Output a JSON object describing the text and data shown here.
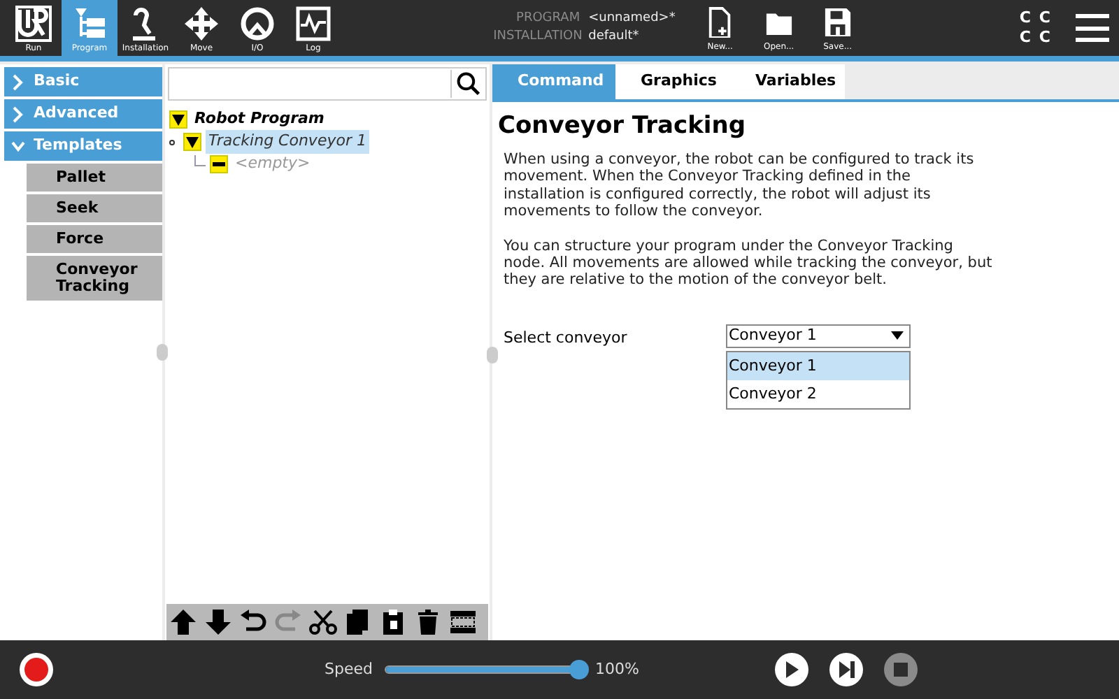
{
  "nav": [
    {
      "kind": "run",
      "label": "Run",
      "selected": false
    },
    {
      "kind": "program",
      "label": "Program",
      "selected": true
    },
    {
      "kind": "installation",
      "label": "Installation",
      "selected": false
    },
    {
      "kind": "move",
      "label": "Move",
      "selected": false
    },
    {
      "kind": "io",
      "label": "I/O",
      "selected": false
    },
    {
      "kind": "log",
      "label": "Log",
      "selected": false
    }
  ],
  "file_info": [
    {
      "label": "PROGRAM",
      "value": "<unnamed>*"
    },
    {
      "label": "INSTALLATION",
      "value": "default*"
    }
  ],
  "file_buttons": [
    {
      "kind": "new",
      "label": "New..."
    },
    {
      "kind": "open",
      "label": "Open..."
    },
    {
      "kind": "save",
      "label": "Save..."
    }
  ],
  "status_letters": [
    "C",
    "C",
    "C",
    "C"
  ],
  "sidebar": [
    {
      "label": "Basic",
      "expanded": false
    },
    {
      "label": "Advanced",
      "expanded": false
    },
    {
      "label": "Templates",
      "expanded": true,
      "children": [
        "Pallet",
        "Seek",
        "Force",
        "Conveyor Tracking"
      ]
    }
  ],
  "tree": [
    {
      "label": "Robot Program",
      "kind": "root",
      "selected": false,
      "children": [
        {
          "label": "Tracking Conveyor 1",
          "kind": "node",
          "selected": true,
          "children": [
            {
              "label": "<empty>",
              "kind": "empty",
              "selected": false
            }
          ]
        }
      ]
    }
  ],
  "toolbar": [
    {
      "kind": "up",
      "disabled": false
    },
    {
      "kind": "down",
      "disabled": false
    },
    {
      "kind": "undo",
      "disabled": false
    },
    {
      "kind": "redo",
      "disabled": true
    },
    {
      "kind": "cut",
      "disabled": false
    },
    {
      "kind": "copy",
      "disabled": false
    },
    {
      "kind": "paste",
      "disabled": false
    },
    {
      "kind": "delete",
      "disabled": false
    },
    {
      "kind": "suppress",
      "disabled": false
    }
  ],
  "tabs": [
    {
      "label": "Command",
      "selected": true
    },
    {
      "label": "Graphics",
      "selected": false
    },
    {
      "label": "Variables",
      "selected": false
    }
  ],
  "command": {
    "title": "Conveyor Tracking",
    "paragraphs": [
      "When using a conveyor, the robot can be configured to track its movement. When the Conveyor Tracking defined in the installation is configured correctly, the robot will adjust its movements to follow the conveyor.",
      "You can structure your program under the Conveyor Tracking node. All movements are allowed while tracking the conveyor, but they are relative to the motion of the conveyor belt."
    ],
    "select_label": "Select conveyor",
    "select_value": "Conveyor 1",
    "options": [
      {
        "label": "Conveyor 1",
        "selected": true
      },
      {
        "label": "Conveyor 2",
        "selected": false
      }
    ]
  },
  "footer": {
    "speed_label": "Speed",
    "level": 1.0,
    "reading": "100%",
    "controls": [
      {
        "kind": "play",
        "disabled": false
      },
      {
        "kind": "step",
        "disabled": false
      },
      {
        "kind": "stop",
        "disabled": true
      }
    ]
  }
}
